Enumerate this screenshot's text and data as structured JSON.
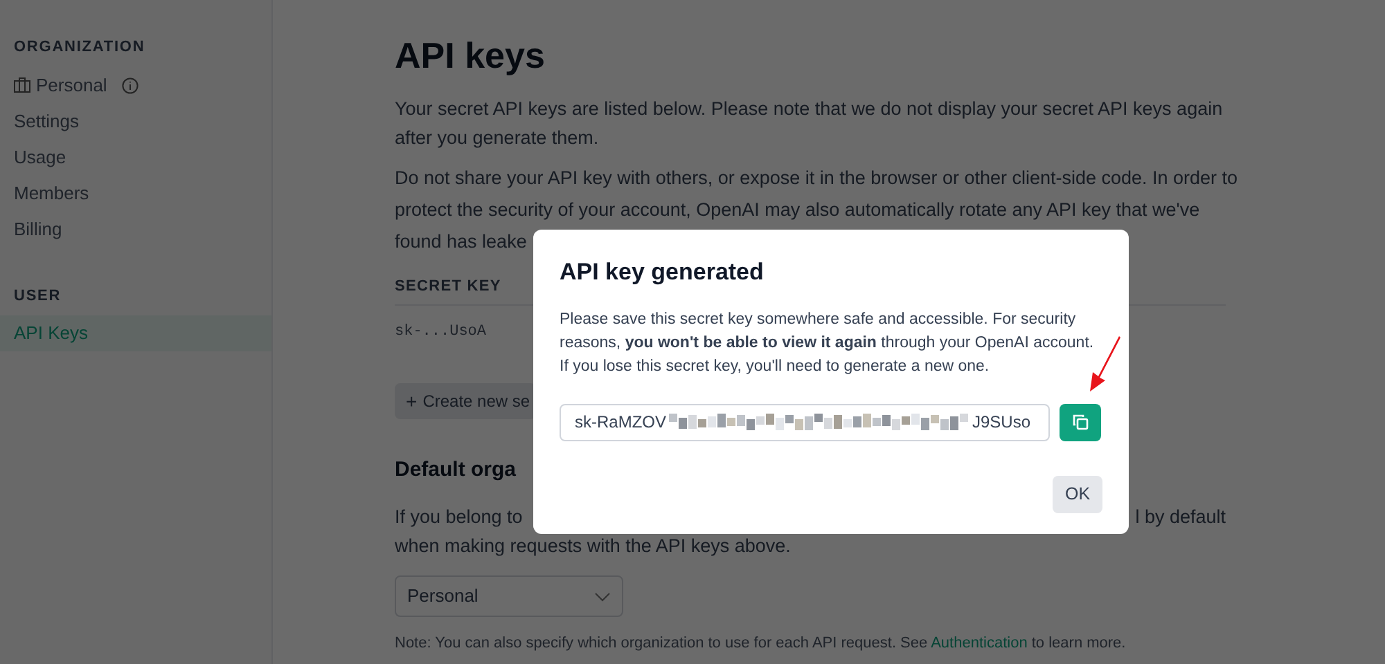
{
  "sidebar": {
    "sections": [
      {
        "heading": "ORGANIZATION",
        "items": [
          {
            "label": "Personal",
            "kind": "org",
            "selected": false
          },
          {
            "label": "Settings",
            "kind": "link",
            "selected": false
          },
          {
            "label": "Usage",
            "kind": "link",
            "selected": false
          },
          {
            "label": "Members",
            "kind": "link",
            "selected": false
          },
          {
            "label": "Billing",
            "kind": "link",
            "selected": false
          }
        ]
      },
      {
        "heading": "USER",
        "items": [
          {
            "label": "API Keys",
            "kind": "link",
            "selected": true
          }
        ]
      }
    ]
  },
  "page": {
    "title": "API keys",
    "paragraphs": [
      [
        "Your secret API keys are listed below. Please note that we do not display your secret API keys again",
        "after you generate them."
      ],
      [
        "Do not share your API key with others, or expose it in the browser or other client-side code. In order to",
        "protect the security of your account, OpenAI may also automatically rotate any API key that we've",
        "found has leake"
      ]
    ],
    "table": {
      "columns": [
        "SECRET KEY"
      ],
      "rows": [
        [
          "sk-...UsoA"
        ]
      ]
    },
    "create_button": {
      "icon": "+",
      "label": "Create new se"
    },
    "default_org": {
      "heading": "Default orga",
      "text_start": "If you belong to",
      "text_end": "l by default",
      "text_line2": "when making requests with the API keys above.",
      "select": {
        "value": "Personal"
      },
      "note_start": "Note: You can also specify which organization to use for each API request. See ",
      "note_link": "Authentication",
      "note_end": " to learn more."
    }
  },
  "dialog": {
    "title": "API key generated",
    "text": "Please save this secret key somewhere safe and accessible. For security reasons, **you won't be able to view it again** through your OpenAI account. If you lose this secret key, you'll need to generate a new one.",
    "key_start": "sk-RaMZOV",
    "key_end": "J9SUso",
    "ok": "OK"
  }
}
